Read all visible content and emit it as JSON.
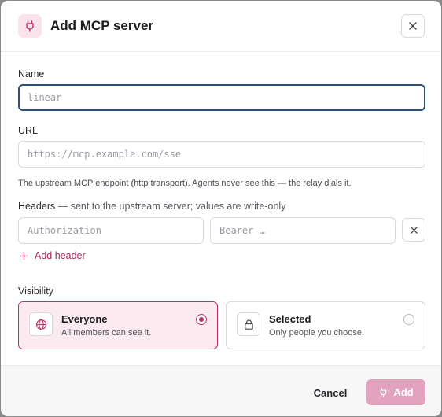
{
  "dialog": {
    "title": "Add MCP server",
    "header_icon": "plug-icon",
    "close_icon": "close-icon"
  },
  "colors": {
    "accent": "#b8336a",
    "accent_light": "#fbeaf0",
    "focus_border": "#2e4f7a",
    "submit_disabled": "#e1a3bd"
  },
  "name": {
    "label": "Name",
    "value": "",
    "placeholder": "linear"
  },
  "url": {
    "label": "URL",
    "value": "",
    "placeholder": "https://mcp.example.com/sse",
    "help": "The upstream MCP endpoint (http transport). Agents never see this — the relay dials it."
  },
  "headers": {
    "label": "Headers",
    "sublabel": "— sent to the upstream server; values are write-only",
    "rows": [
      {
        "key_placeholder": "Authorization",
        "value_placeholder": "Bearer …"
      }
    ],
    "add_label": "Add header"
  },
  "visibility": {
    "label": "Visibility",
    "selected": "everyone",
    "options": [
      {
        "id": "everyone",
        "title": "Everyone",
        "description": "All members can see it.",
        "icon": "globe-icon"
      },
      {
        "id": "selected",
        "title": "Selected",
        "description": "Only people you choose.",
        "icon": "lock-icon"
      }
    ]
  },
  "footer": {
    "cancel_label": "Cancel",
    "submit_label": "Add"
  }
}
